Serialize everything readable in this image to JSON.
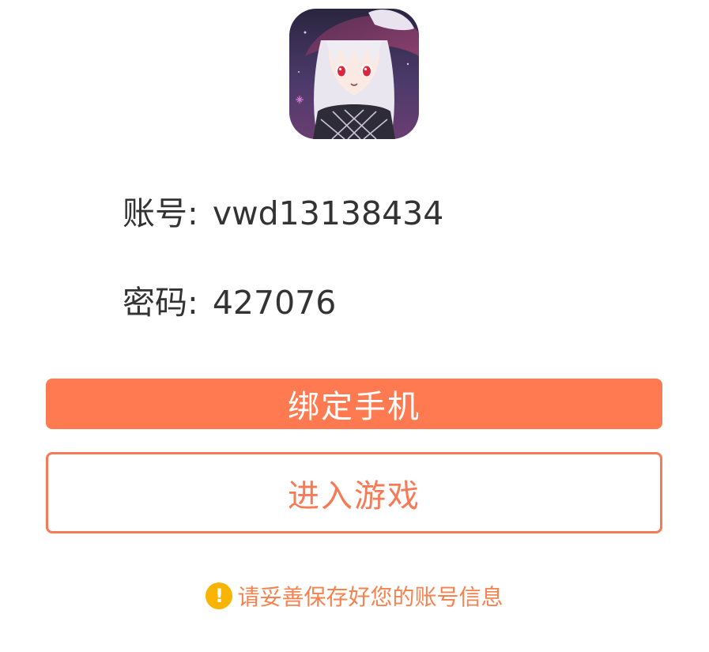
{
  "app": {
    "icon_name": "anime-character-app-icon"
  },
  "account": {
    "label": "账号",
    "separator": ":",
    "value": "vwd13138434"
  },
  "password": {
    "label": "密码",
    "separator": ":",
    "value": "427076"
  },
  "buttons": {
    "bind_phone_label": "绑定手机",
    "enter_game_label": "进入游戏"
  },
  "notice": {
    "icon": "exclamation-icon",
    "text": "请妥善保存好您的账号信息"
  },
  "colors": {
    "primary": "#ff7a50",
    "outline": "#f57a55",
    "notice_text": "#f5824f",
    "warning_icon": "#f8b400"
  }
}
